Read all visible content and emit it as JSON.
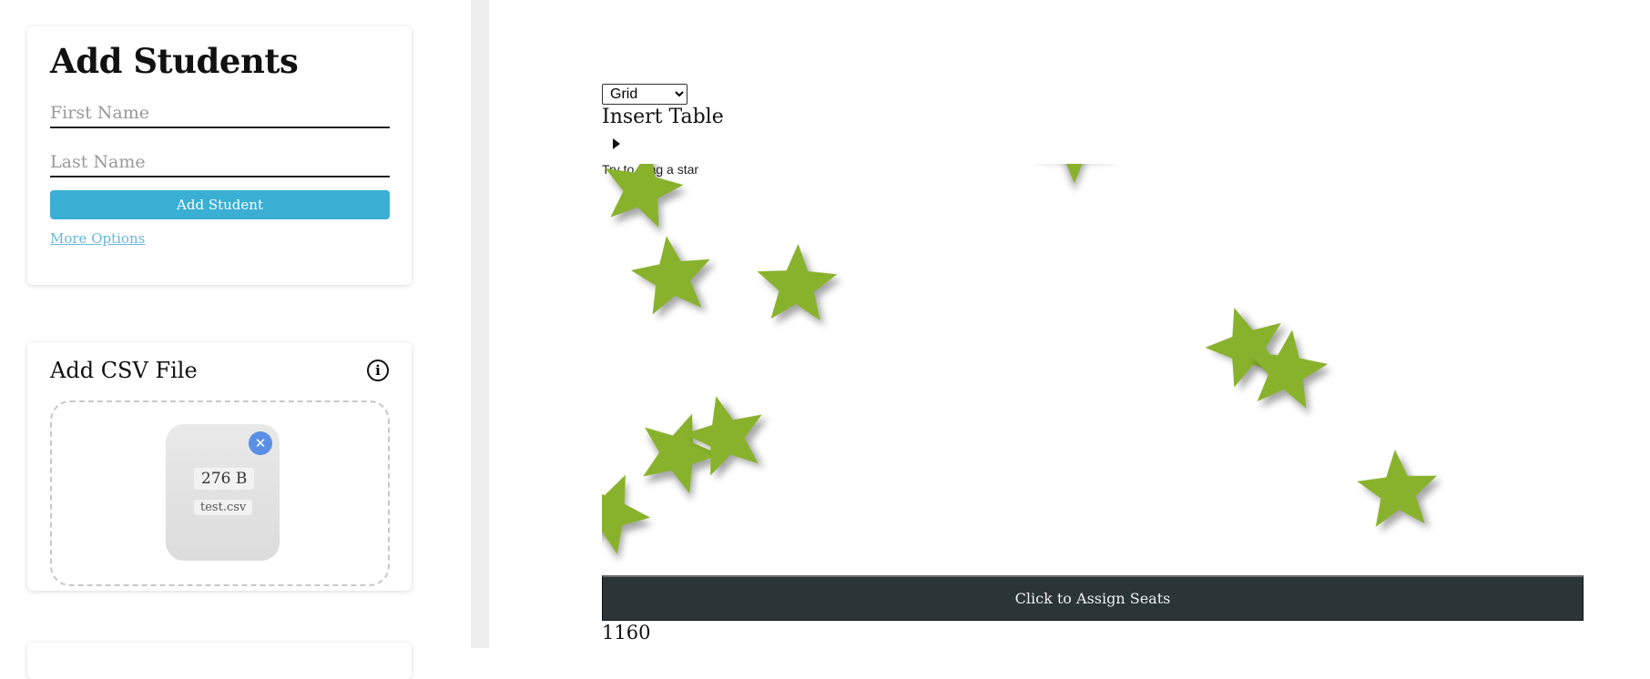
{
  "add_students": {
    "title": "Add Students",
    "first_name_placeholder": "First Name",
    "last_name_placeholder": "Last Name",
    "add_button": "Add Student",
    "more_options": "More Options"
  },
  "csv": {
    "title": "Add CSV File",
    "info_icon": "info-icon",
    "file": {
      "size": "276 B",
      "name": "test.csv"
    }
  },
  "main": {
    "layout_select": {
      "selected": "Grid",
      "options": [
        "Grid"
      ]
    },
    "insert_table": "Insert Table",
    "drag_hint": "Try to drag a star",
    "assign_button": "Click to Assign Seats",
    "counter": "1160",
    "star_color": "#88b22c"
  }
}
